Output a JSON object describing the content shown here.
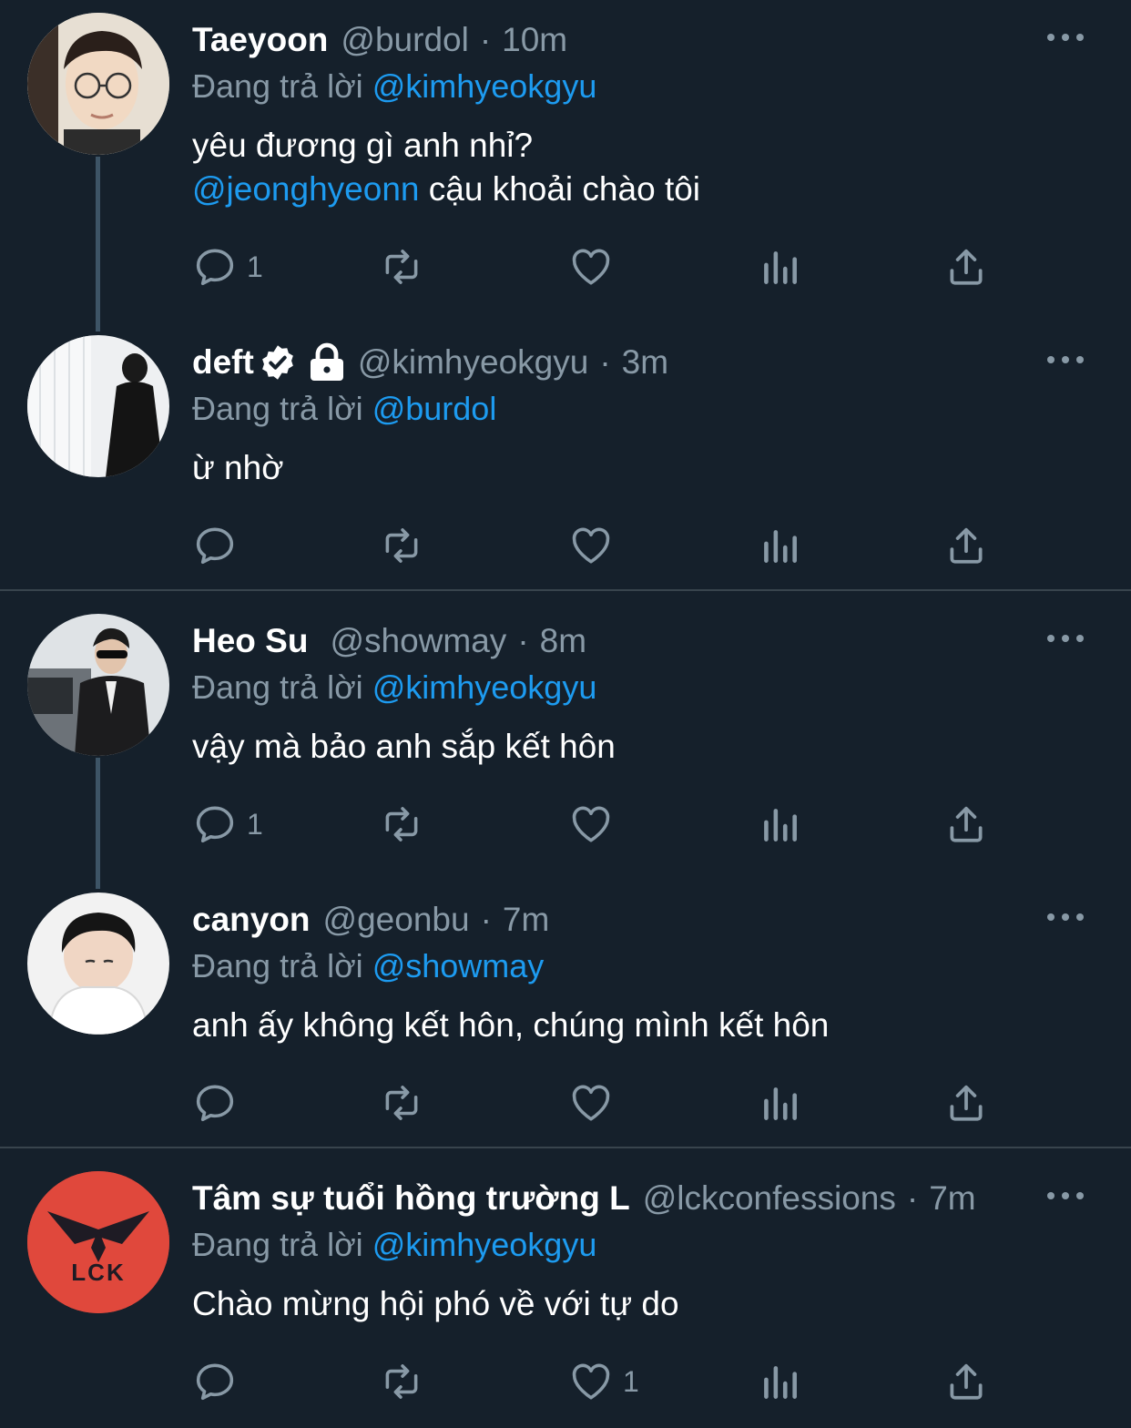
{
  "tweets": [
    {
      "name": "Taeyoon",
      "handle": "@burdol",
      "dot": "·",
      "time": "10m",
      "reply_label": "Đang trả lời",
      "reply_to": "@kimhyeokgyu",
      "body_line1": "yêu đương gì anh nhỉ?",
      "body_mention": "@jeonghyeonn",
      "body_line2_rest": " cậu khoải chào tôi",
      "reply_count": "1",
      "like_count": ""
    },
    {
      "name": "deft",
      "handle": "@kimhyeokgyu",
      "dot": "·",
      "time": "3m",
      "reply_label": "Đang trả lời",
      "reply_to": "@burdol",
      "body_line1": "ừ nhờ",
      "reply_count": "",
      "like_count": ""
    },
    {
      "name": "Heo Su",
      "handle": "@showmay",
      "dot": "·",
      "time": "8m",
      "reply_label": "Đang trả lời",
      "reply_to": "@kimhyeokgyu",
      "body_line1": "vậy mà bảo anh sắp kết hôn",
      "reply_count": "1",
      "like_count": ""
    },
    {
      "name": "canyon",
      "handle": "@geonbu",
      "dot": "·",
      "time": "7m",
      "reply_label": "Đang trả lời",
      "reply_to": "@showmay",
      "body_line1": "anh ấy không kết hôn, chúng mình kết hôn",
      "reply_count": "",
      "like_count": ""
    },
    {
      "name": "Tâm sự tuổi hồng trường L",
      "handle": "@lckconfessions",
      "dot": "·",
      "time": "7m",
      "reply_label": "Đang trả lời",
      "reply_to": "@kimhyeokgyu",
      "body_line1": "Chào mừng hội phó về với tự do",
      "avatar_logo_text": "LCK",
      "reply_count": "",
      "like_count": "1"
    }
  ],
  "colors": {
    "background": "#15202b",
    "muted": "#8899a6",
    "link": "#1d9bf0",
    "divider": "#38444d",
    "lck_red": "#e0483c"
  },
  "icons": [
    "more-icon",
    "reply-icon",
    "retweet-icon",
    "like-icon",
    "analytics-icon",
    "share-icon",
    "verified-icon",
    "lock-icon"
  ]
}
